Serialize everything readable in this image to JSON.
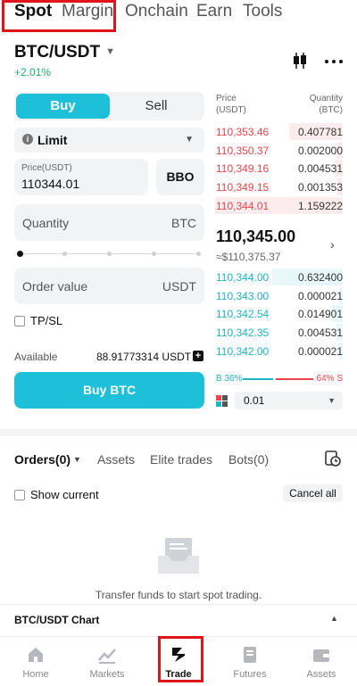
{
  "top_tabs": [
    "Spot",
    "Margin",
    "Onchain",
    "Earn",
    "Tools"
  ],
  "pair": {
    "symbol": "BTC/USDT",
    "change": "+2.01%"
  },
  "trade_side": {
    "buy": "Buy",
    "sell": "Sell"
  },
  "order_type": "Limit",
  "price_field": {
    "label": "Price(USDT)",
    "value": "110344.01"
  },
  "bbo_label": "BBO",
  "quantity_field": {
    "placeholder": "Quantity",
    "unit": "BTC"
  },
  "order_value_field": {
    "placeholder": "Order value",
    "unit": "USDT"
  },
  "tpsl_label": "TP/SL",
  "available": {
    "label": "Available",
    "value": "88.91773314 USDT"
  },
  "buy_button": "Buy BTC",
  "order_book": {
    "price_header": [
      "Price",
      "(USDT)"
    ],
    "qty_header": [
      "Quantity",
      "(BTC)"
    ],
    "asks": [
      {
        "price": "110,353.46",
        "qty": "0.407781",
        "depth": 0.42
      },
      {
        "price": "110,350.37",
        "qty": "0.002000",
        "depth": 0.05
      },
      {
        "price": "110,349.16",
        "qty": "0.004531",
        "depth": 0.06
      },
      {
        "price": "110,349.15",
        "qty": "0.001353",
        "depth": 0.04
      },
      {
        "price": "110,344.01",
        "qty": "1.159222",
        "depth": 0.99
      }
    ],
    "last_price": "110,345.00",
    "last_price_usd": "≈$110,375.37",
    "bids": [
      {
        "price": "110,344.00",
        "qty": "0.632400",
        "depth": 0.55
      },
      {
        "price": "110,343.00",
        "qty": "0.000021",
        "depth": 0.03
      },
      {
        "price": "110,342.54",
        "qty": "0.014901",
        "depth": 0.08
      },
      {
        "price": "110,342.35",
        "qty": "0.004531",
        "depth": 0.05
      },
      {
        "price": "110,342.00",
        "qty": "0.000021",
        "depth": 0.03
      }
    ],
    "buy_ratio": "B 36%",
    "sell_ratio": "64% S",
    "precision": "0.01"
  },
  "orders_tabs": [
    "Orders(0)",
    "Assets",
    "Elite trades",
    "Bots(0)"
  ],
  "show_current_label": "Show current",
  "cancel_all_label": "Cancel all",
  "empty_message": "Transfer funds to start spot trading.",
  "chart_toggle_label": "BTC/USDT Chart",
  "bottom_nav": [
    "Home",
    "Markets",
    "Trade",
    "Futures",
    "Assets"
  ],
  "colors": {
    "accent": "#1ebfd8",
    "ask": "#ef454a",
    "bid": "#1fb3c7",
    "highlight_box": "#e0151b"
  }
}
